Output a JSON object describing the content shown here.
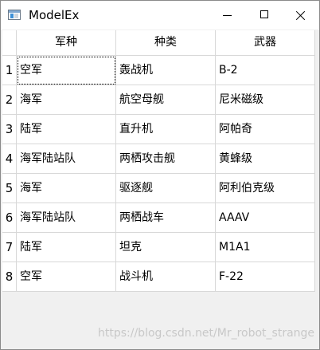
{
  "window": {
    "title": "ModelEx",
    "icon": "app-window-icon",
    "controls": [
      "minimize",
      "maximize",
      "close"
    ]
  },
  "table": {
    "columns": [
      "军种",
      "种类",
      "武器"
    ],
    "row_numbers": [
      "1",
      "2",
      "3",
      "4",
      "5",
      "6",
      "7",
      "8"
    ],
    "rows": [
      [
        "空军",
        "轰战机",
        "B-2"
      ],
      [
        "海军",
        "航空母舰",
        "尼米磁级"
      ],
      [
        "陆军",
        "直升机",
        "阿帕奇"
      ],
      [
        "海军陆站队",
        "两栖攻击舰",
        "黄蜂级"
      ],
      [
        "海军",
        "驱逐舰",
        "阿利伯克级"
      ],
      [
        "海军陆站队",
        "两栖战车",
        "AAAV"
      ],
      [
        "陆军",
        "坦克",
        "M1A1"
      ],
      [
        "空军",
        "战斗机",
        "F-22"
      ]
    ],
    "current_cell": "row 1, column 1"
  },
  "watermark": "https://blog.csdn.net/Mr_robot_strange"
}
